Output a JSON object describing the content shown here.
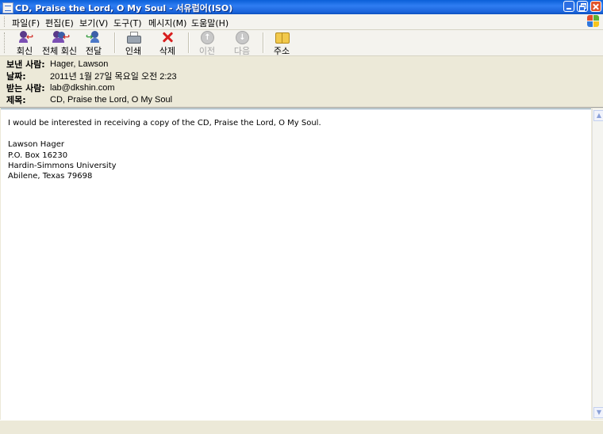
{
  "window": {
    "title": "CD, Praise the Lord, O My Soul - 서유럽어(ISO)"
  },
  "menu": [
    "파일(F)",
    "편집(E)",
    "보기(V)",
    "도구(T)",
    "메시지(M)",
    "도움말(H)"
  ],
  "toolbar": {
    "reply": "회신",
    "reply_all": "전체 회신",
    "forward": "전달",
    "print": "인쇄",
    "delete": "삭제",
    "previous": "이전",
    "next": "다음",
    "addresses": "주소"
  },
  "headers": {
    "from_label": "보낸 사람:",
    "from": "Hager, Lawson",
    "date_label": "날짜:",
    "date": "2011년 1월 27일 목요일 오전 2:23",
    "to_label": "받는 사람:",
    "to": "lab@dkshin.com",
    "subject_label": "제목:",
    "subject": "CD, Praise the Lord, O My Soul"
  },
  "body": {
    "line1": "I would be interested in receiving a copy of the CD, Praise the Lord, O My Soul.",
    "sig_name": "Lawson Hager",
    "sig_box": "P.O. Box 16230",
    "sig_univ": "Hardin-Simmons University",
    "sig_city": "Abilene, Texas 79698"
  }
}
